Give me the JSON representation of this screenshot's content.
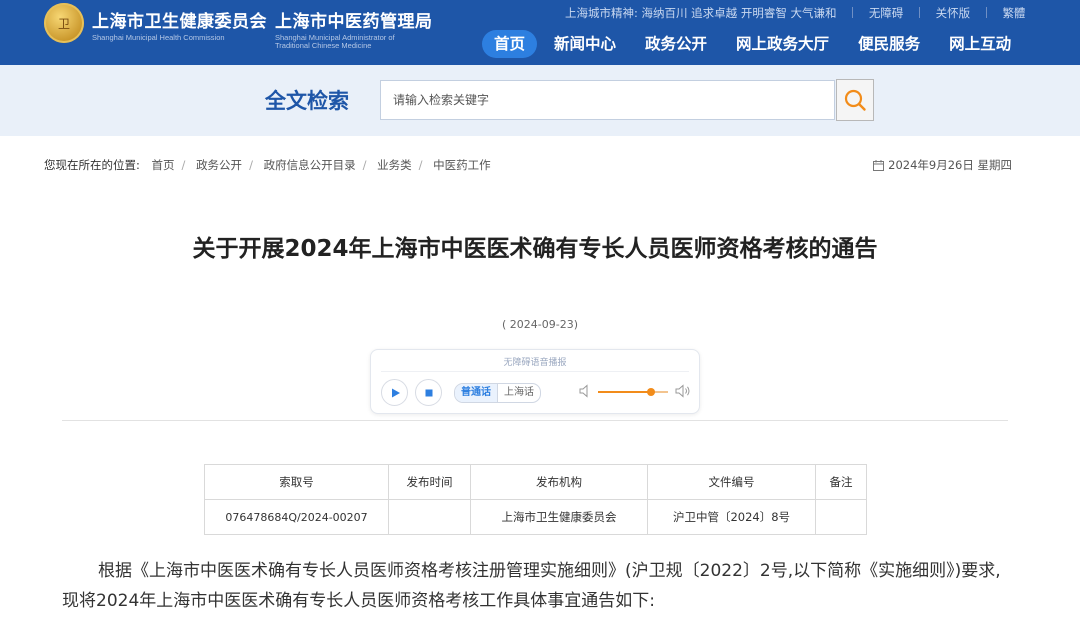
{
  "header": {
    "emblem_text": "卫",
    "org1_cn": "上海市卫生健康委员会",
    "org1_en": "Shanghai Municipal Health Commission",
    "org2_cn": "上海市中医药管理局",
    "org2_en_line1": "Shanghai Municipal Administrator of",
    "org2_en_line2": "Traditional Chinese Medicine",
    "spirit": "上海城市精神: 海纳百川 追求卓越 开明睿智 大气谦和",
    "accessibility": "无障碍",
    "care_mode": "关怀版",
    "traditional": "繁體",
    "nav": [
      "首页",
      "新闻中心",
      "政务公开",
      "网上政务大厅",
      "便民服务",
      "网上互动"
    ]
  },
  "search": {
    "title": "全文检索",
    "placeholder": "请输入检索关键字"
  },
  "breadcrumb": {
    "lead": "您现在所在的位置:",
    "items": [
      "首页",
      "政务公开",
      "政府信息公开目录",
      "业务类",
      "中医药工作"
    ],
    "date": "2024年9月26日 星期四"
  },
  "article": {
    "title": "关于开展2024年上海市中医医术确有专长人员医师资格考核的通告",
    "pubdate": "( 2024-09-23)",
    "player": {
      "caption": "无障碍语音播报",
      "lang_on": "普通话",
      "lang_off": "上海话",
      "volume": 0.75
    },
    "meta_headers": [
      "索取号",
      "发布时间",
      "发布机构",
      "文件编号",
      "备注"
    ],
    "meta_values": [
      "076478684Q/2024-00207",
      "",
      "上海市卫生健康委员会",
      "沪卫中管〔2024〕8号",
      ""
    ],
    "body": "根据《上海市中医医术确有专长人员医师资格考核注册管理实施细则》(沪卫规〔2022〕2号,以下简称《实施细则》)要求,现将2024年上海市中医医术确有专长人员医师资格考核工作具体事宜通告如下:"
  },
  "colors": {
    "header_blue": "#1e56a8",
    "nav_active": "#2d7fe0",
    "search_band": "#e9f0f9",
    "accent_orange": "#f28c1a"
  }
}
